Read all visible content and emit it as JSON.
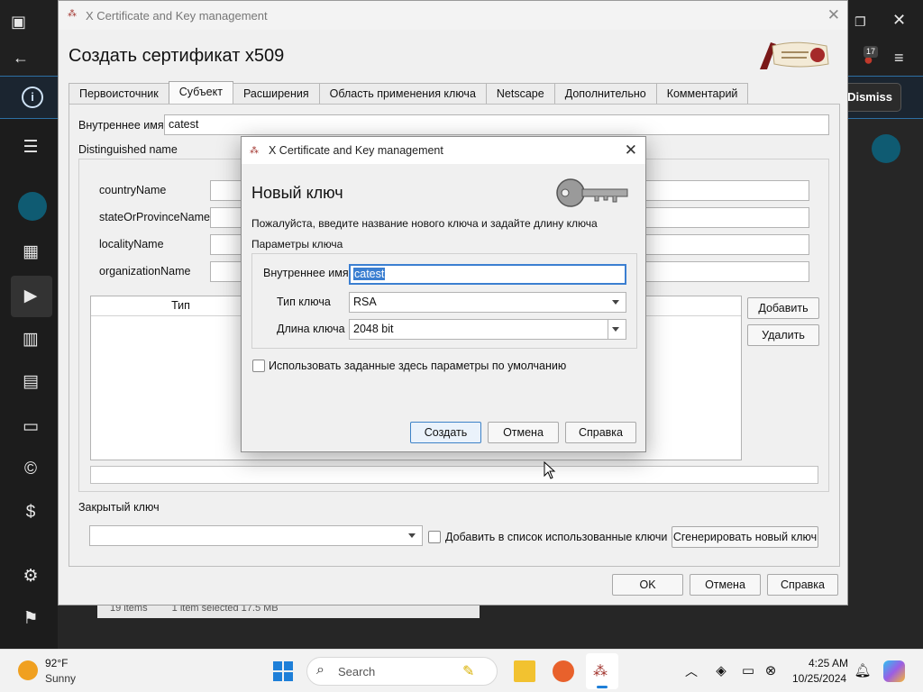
{
  "background": {
    "dismiss_label": "Dismiss",
    "badge_count": "17",
    "status_items": "19 items",
    "status_selected": "1 item selected  17.5 MB"
  },
  "main_dialog": {
    "window_title": "X Certificate and Key management",
    "heading": "Создать сертификат x509",
    "tabs": [
      {
        "label": "Первоисточник"
      },
      {
        "label": "Субъект",
        "active": true
      },
      {
        "label": "Расширения"
      },
      {
        "label": "Область применения ключа"
      },
      {
        "label": "Netscape"
      },
      {
        "label": "Дополнительно"
      },
      {
        "label": "Комментарий"
      }
    ],
    "internal_name_label": "Внутреннее имя",
    "internal_name_value": "catest",
    "distinguished_name_label": "Distinguished name",
    "dn_fields": [
      {
        "label": "countryName"
      },
      {
        "label": "stateOrProvinceName"
      },
      {
        "label": "localityName"
      },
      {
        "label": "organizationName"
      }
    ],
    "table_header_type": "Тип",
    "add_button": "Добавить",
    "delete_button": "Удалить",
    "private_key_label": "Закрытый ключ",
    "add_to_used_keys_label": "Добавить в список использованные ключи",
    "generate_key_button": "Сгенерировать новый ключ",
    "ok_button": "OK",
    "cancel_button": "Отмена",
    "help_button": "Справка"
  },
  "modal": {
    "window_title": "X Certificate and Key management",
    "heading": "Новый ключ",
    "description": "Пожалуйста, введите название нового ключа и задайте длину ключа",
    "group_label": "Параметры ключа",
    "internal_name_label": "Внутреннее имя",
    "internal_name_value": "catest",
    "key_type_label": "Тип ключа",
    "key_type_value": "RSA",
    "key_length_label": "Длина ключа",
    "key_length_value": "2048 bit",
    "use_defaults_label": "Использовать заданные здесь параметры по умолчанию",
    "create_button": "Создать",
    "cancel_button": "Отмена",
    "help_button": "Справка"
  },
  "taskbar": {
    "weather_temp": "92°F",
    "weather_desc": "Sunny",
    "search_placeholder": "Search",
    "time": "4:25 AM",
    "date": "10/25/2024"
  },
  "colors": {
    "accent": "#3b7fd1",
    "info_bar_border": "#2d6fa3",
    "sidebar_circle": "#0f5b72"
  }
}
